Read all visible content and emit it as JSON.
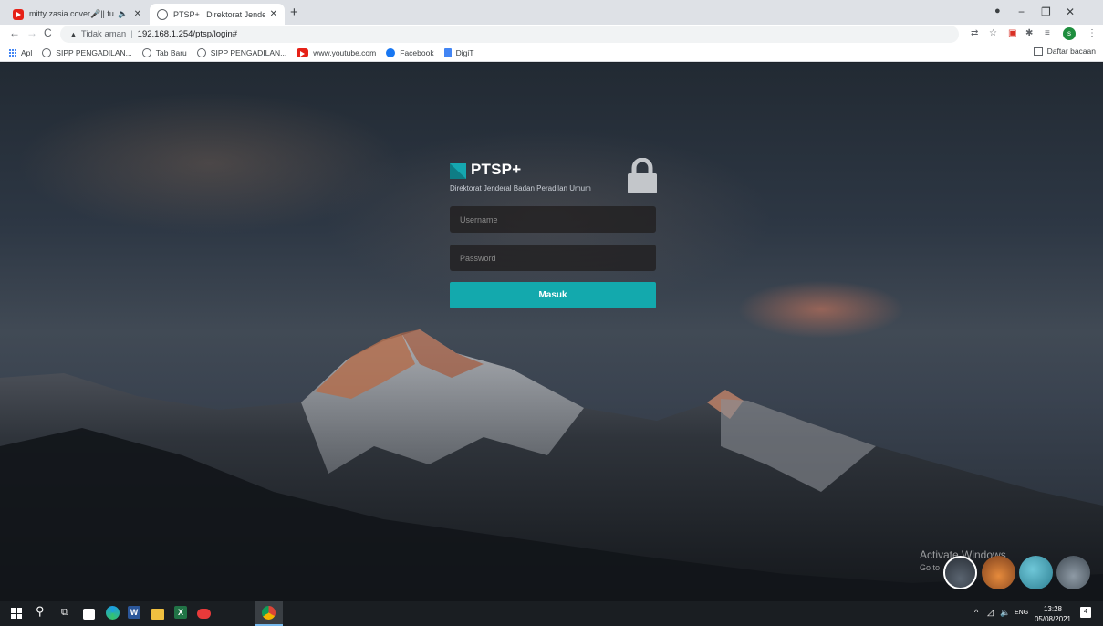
{
  "browser": {
    "tabs": [
      {
        "title": "mitty zasia cover🎤|| full albu",
        "favicon": "youtube-icon"
      },
      {
        "title": "PTSP+ | Direktorat Jenderal Bada",
        "favicon": "globe-icon"
      }
    ],
    "address": {
      "security_label": "Tidak aman",
      "url": "192.168.1.254/ptsp/login#"
    },
    "profile_initial": "s",
    "bookmarks": [
      {
        "label": "Apl",
        "icon": "apps-icon"
      },
      {
        "label": "SIPP PENGADILAN...",
        "icon": "globe-icon"
      },
      {
        "label": "Tab Baru",
        "icon": "globe-icon"
      },
      {
        "label": "SIPP PENGADILAN...",
        "icon": "globe-icon"
      },
      {
        "label": "www.youtube.com",
        "icon": "youtube-icon"
      },
      {
        "label": "Facebook",
        "icon": "facebook-icon"
      },
      {
        "label": "DigiT",
        "icon": "document-icon"
      }
    ],
    "reading_list_label": "Daftar bacaan"
  },
  "login": {
    "brand": "PTSP+",
    "subtitle": "Direktorat Jenderal Badan Peradilan Umum",
    "username_placeholder": "Username",
    "password_placeholder": "Password",
    "submit_label": "Masuk",
    "accent_color": "#13a9ad"
  },
  "watermark": {
    "line1": "Activate Windows",
    "line2": "Go to"
  },
  "taskbar": {
    "language": "ENG",
    "time": "13:28",
    "date": "05/08/2021",
    "notification_count": "4"
  }
}
